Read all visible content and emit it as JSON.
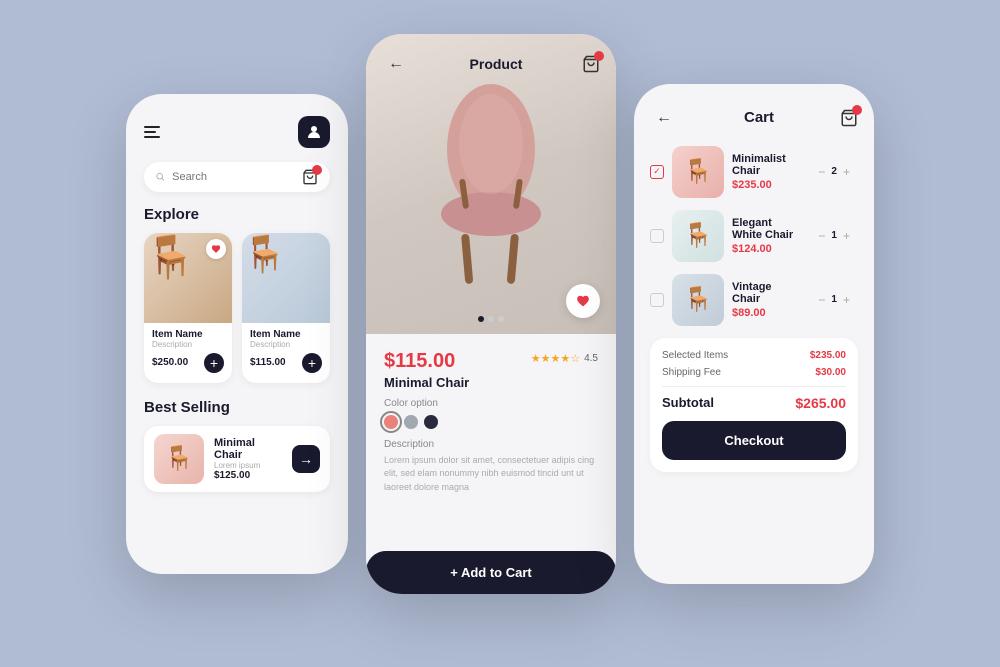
{
  "app": {
    "bg_color": "#b0bcd4"
  },
  "phone_explore": {
    "header": {
      "profile_icon": "👤"
    },
    "search": {
      "placeholder": "Search"
    },
    "explore": {
      "title": "Explore",
      "items": [
        {
          "name": "Item Name",
          "description": "Description",
          "price": "$250.00",
          "has_heart": true
        },
        {
          "name": "Item Name",
          "description": "Description",
          "price": "$115.00",
          "has_heart": false
        }
      ]
    },
    "best_selling": {
      "title": "Best Selling",
      "items": [
        {
          "name": "Minimal Chair",
          "subtitle": "Lorem ipsum",
          "price": "$125.00"
        }
      ]
    },
    "cart_badge": "0"
  },
  "phone_product": {
    "nav_title": "Product",
    "price": "$115.00",
    "product_name": "Minimal Chair",
    "rating": "4.5",
    "color_label": "Color option",
    "colors": [
      "#e8827a",
      "#a0a8b0",
      "#2a2a3e"
    ],
    "desc_label": "Description",
    "desc_text": "Lorem ipsum dolor sit amet, consectetuer adipis cing elit, sed elam nonummy nibh euismod tincid unt ut laoreet dolore magna",
    "add_to_cart": "+ Add to Cart",
    "cart_badge": "0"
  },
  "phone_cart": {
    "title": "Cart",
    "items": [
      {
        "name": "Minimalist Chair",
        "price": "$235.00",
        "quantity": "2",
        "checked": true
      },
      {
        "name": "Elegant White Chair",
        "price": "$124.00",
        "quantity": "1",
        "checked": false
      },
      {
        "name": "Vintage Chair",
        "price": "$89.00",
        "quantity": "1",
        "checked": false
      }
    ],
    "summary": {
      "selected_label": "Selected Items",
      "selected_value": "$235.00",
      "shipping_label": "Shipping Fee",
      "shipping_value": "$30.00",
      "subtotal_label": "Subtotal",
      "subtotal_value": "$265.00"
    },
    "checkout_label": "Checkout",
    "cart_badge": "0"
  }
}
